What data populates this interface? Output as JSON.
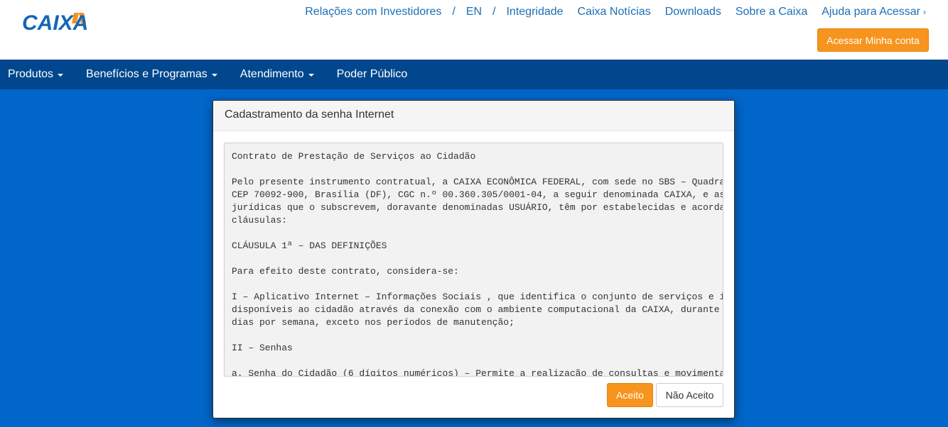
{
  "header": {
    "logo_text": "CAIXA",
    "links": [
      "Relações com Investidores",
      "EN",
      "Integridade",
      "Caixa Notícias",
      "Downloads",
      "Sobre a Caixa",
      "Ajuda para Acessar"
    ],
    "separator": "/",
    "chevron": "›",
    "access_button": "Acessar Minha conta"
  },
  "nav": {
    "items": [
      {
        "label": "Produtos",
        "has_caret": true
      },
      {
        "label": "Benefícios e Programas",
        "has_caret": true
      },
      {
        "label": "Atendimento",
        "has_caret": true
      },
      {
        "label": "Poder Público",
        "has_caret": false
      }
    ]
  },
  "modal": {
    "title": "Cadastramento da senha Internet",
    "contract_lines": [
      "Contrato de Prestação de Serviços ao Cidadão",
      "",
      "Pelo presente instrumento contratual, a CAIXA ECONÔMICA FEDERAL, com sede no SBS – Quadra",
      "CEP 70092-900, Brasília (DF), CGC n.º 00.360.305/0001-04, a seguir denominada CAIXA, e as",
      "jurídicas que o subscrevem, doravante denominadas USUÁRIO, têm por estabelecidas e acorda",
      "cláusulas:",
      "",
      "CLÁUSULA 1ª – DAS DEFINIÇÕES",
      "",
      "Para efeito deste contrato, considera-se:",
      "",
      "I – Aplicativo Internet – Informações Sociais , que identifica o conjunto de serviços e i",
      "disponíveis ao cidadão através da conexão com o ambiente computacional da CAIXA, durante",
      "dias por semana, exceto nos períodos de manutenção;",
      "",
      "II – Senhas",
      "",
      "a. Senha do Cidadão (6 dígitos numéricos) – Permite a realização de consultas e movimenta"
    ],
    "accept_button": "Aceito",
    "decline_button": "Não Aceito"
  },
  "colors": {
    "brand_blue": "#00478d",
    "background_blue": "#0066c9",
    "accent_orange": "#f7941d",
    "link_blue": "#1c6fb6"
  }
}
